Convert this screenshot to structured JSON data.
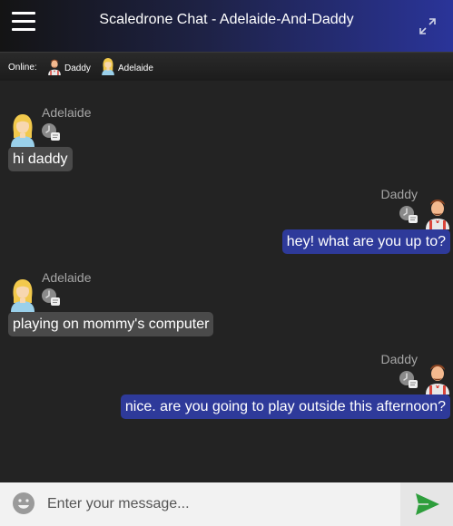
{
  "header": {
    "title": "Scaledrone Chat - Adelaide-And-Daddy",
    "menu_icon": "hamburger-menu-icon",
    "expand_icon": "expand-icon"
  },
  "online": {
    "label": "Online:",
    "members": [
      {
        "name": "Daddy",
        "avatar": "man-avatar-icon"
      },
      {
        "name": "Adelaide",
        "avatar": "girl-avatar-icon"
      }
    ]
  },
  "messages": [
    {
      "sender": "Adelaide",
      "side": "left",
      "text": "hi daddy"
    },
    {
      "sender": "Daddy",
      "side": "right",
      "text": "hey! what are you up to?"
    },
    {
      "sender": "Adelaide",
      "side": "left",
      "text": "playing on mommy's computer"
    },
    {
      "sender": "Daddy",
      "side": "right",
      "text": "nice. are you going to play outside this afternoon?"
    }
  ],
  "composer": {
    "placeholder": "Enter your message...",
    "emoji_icon": "emoji-icon",
    "send_icon": "send-icon"
  },
  "colors": {
    "header_gradient_end": "#2a3499",
    "own_bubble": "#2e3a9a",
    "other_bubble": "#4a4a4a",
    "send_icon": "#2e9e3c",
    "background": "#232323"
  }
}
